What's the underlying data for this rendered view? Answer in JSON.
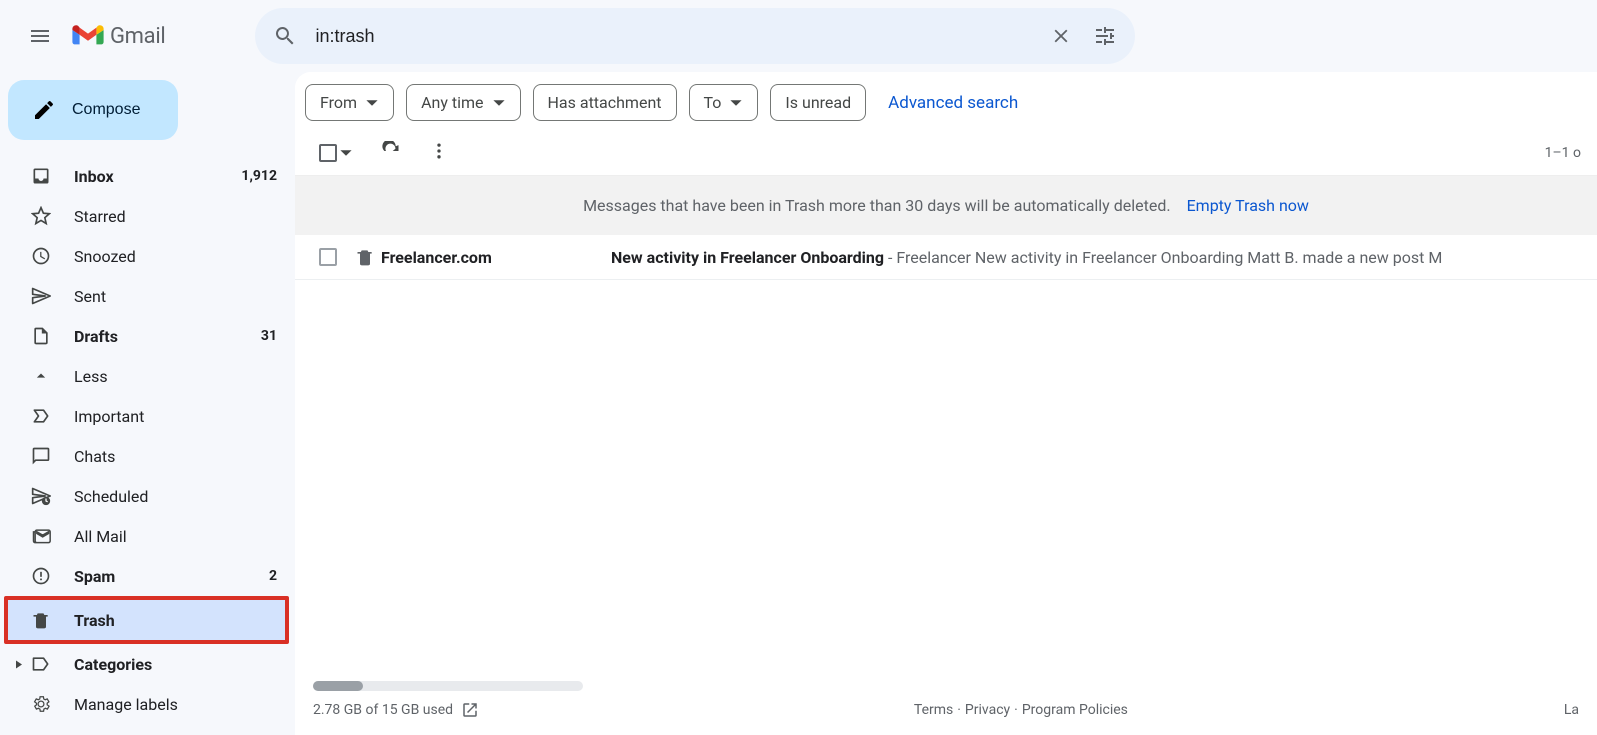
{
  "header": {
    "app_name": "Gmail",
    "search_value": "in:trash"
  },
  "compose_label": "Compose",
  "nav": {
    "inbox": {
      "label": "Inbox",
      "count": "1,912"
    },
    "starred": {
      "label": "Starred"
    },
    "snoozed": {
      "label": "Snoozed"
    },
    "sent": {
      "label": "Sent"
    },
    "drafts": {
      "label": "Drafts",
      "count": "31"
    },
    "less": {
      "label": "Less"
    },
    "important": {
      "label": "Important"
    },
    "chats": {
      "label": "Chats"
    },
    "scheduled": {
      "label": "Scheduled"
    },
    "allmail": {
      "label": "All Mail"
    },
    "spam": {
      "label": "Spam",
      "count": "2"
    },
    "trash": {
      "label": "Trash"
    },
    "categories": {
      "label": "Categories"
    },
    "manage": {
      "label": "Manage labels"
    }
  },
  "filters": {
    "from": "From",
    "anytime": "Any time",
    "has_attachment": "Has attachment",
    "to": "To",
    "is_unread": "Is unread",
    "advanced": "Advanced search"
  },
  "toolbar": {
    "page_counter": "1–1 o"
  },
  "notice": {
    "text": "Messages that have been in Trash more than 30 days will be automatically deleted.",
    "action": "Empty Trash now"
  },
  "messages": [
    {
      "sender": "Freelancer.com",
      "subject": "New activity in Freelancer Onboarding",
      "snippet": " - Freelancer New activity in Freelancer Onboarding Matt B. made a new post M"
    }
  ],
  "footer": {
    "storage": "2.78 GB of 15 GB used",
    "terms": "Terms",
    "privacy": "Privacy",
    "policies": "Program Policies",
    "dot": " · ",
    "last": "La"
  }
}
